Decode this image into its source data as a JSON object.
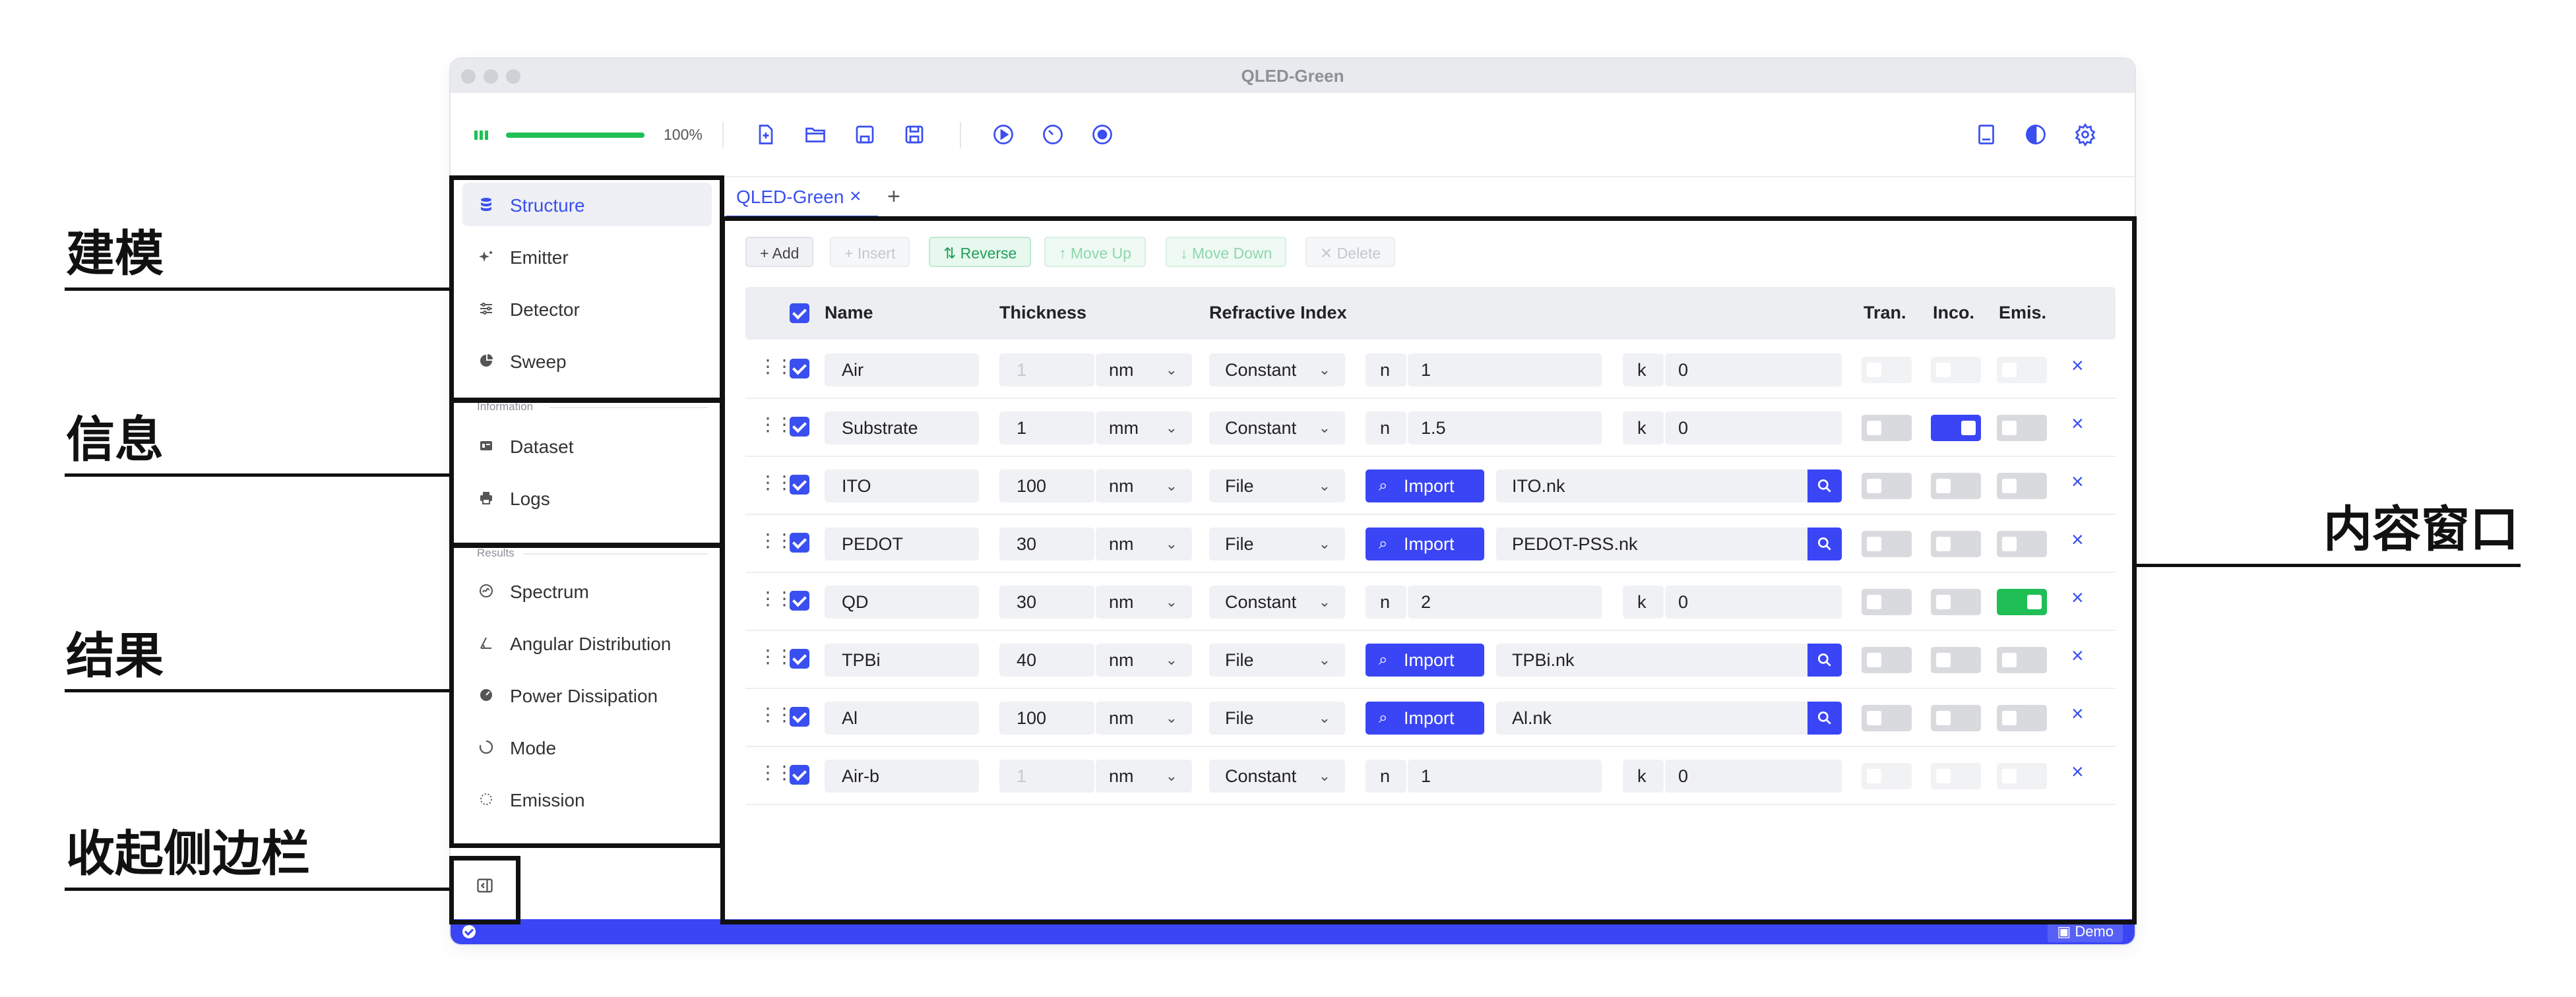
{
  "annotations": {
    "modeling": "建模",
    "info": "信息",
    "results": "结果",
    "collapse_sidebar": "收起侧边栏",
    "content_window": "内容窗口"
  },
  "window": {
    "title": "QLED-Green"
  },
  "toolbar": {
    "progress_percent": "100%",
    "progress_fraction": 1.0,
    "left_icons": [
      "new-file-icon",
      "open-folder-icon",
      "save-icon",
      "save-as-icon"
    ],
    "run_icons": [
      "play-icon",
      "timer-icon",
      "record-icon"
    ],
    "right_icons": [
      "book-icon",
      "theme-icon",
      "settings-icon"
    ]
  },
  "sidebar": {
    "items": [
      {
        "label": "Structure",
        "icon": "database-icon"
      },
      {
        "label": "Emitter",
        "icon": "sparkle-icon"
      },
      {
        "label": "Detector",
        "icon": "sliders-icon"
      },
      {
        "label": "Sweep",
        "icon": "pie-icon"
      }
    ],
    "info_section": "Information",
    "info_items": [
      {
        "label": "Dataset",
        "icon": "dataset-icon"
      },
      {
        "label": "Logs",
        "icon": "printer-icon"
      }
    ],
    "results_section": "Results",
    "results_items": [
      {
        "label": "Spectrum",
        "icon": "spectrum-icon"
      },
      {
        "label": "Angular Distribution",
        "icon": "angle-icon"
      },
      {
        "label": "Power Dissipation",
        "icon": "power-icon"
      },
      {
        "label": "Mode",
        "icon": "mode-icon"
      },
      {
        "label": "Emission",
        "icon": "emission-icon"
      }
    ]
  },
  "tabs": [
    {
      "label": "QLED-Green"
    }
  ],
  "actions": {
    "add": "+ Add",
    "insert": "+ Insert",
    "reverse": "⇅ Reverse",
    "move_up": "↑ Move Up",
    "move_down": "↓ Move Down",
    "delete": "✕ Delete"
  },
  "table": {
    "headers": {
      "name": "Name",
      "thickness": "Thickness",
      "refractive_index": "Refractive Index",
      "tran": "Tran.",
      "inco": "Inco.",
      "emis": "Emis."
    },
    "rows": [
      {
        "name": "Air",
        "thickness": "1",
        "unit": "nm",
        "method": "Constant",
        "n": "1",
        "k": "0",
        "file": "",
        "tran": false,
        "inco": false,
        "emis": false,
        "muted": true
      },
      {
        "name": "Substrate",
        "thickness": "1",
        "unit": "mm",
        "method": "Constant",
        "n": "1.5",
        "k": "0",
        "file": "",
        "tran": false,
        "inco": true,
        "emis": false,
        "muted": false
      },
      {
        "name": "ITO",
        "thickness": "100",
        "unit": "nm",
        "method": "File",
        "file": "ITO.nk",
        "import_label": "Import",
        "tran": false,
        "inco": false,
        "emis": false,
        "muted": false
      },
      {
        "name": "PEDOT",
        "thickness": "30",
        "unit": "nm",
        "method": "File",
        "file": "PEDOT-PSS.nk",
        "import_label": "Import",
        "tran": false,
        "inco": false,
        "emis": false,
        "muted": false
      },
      {
        "name": "QD",
        "thickness": "30",
        "unit": "nm",
        "method": "Constant",
        "n": "2",
        "k": "0",
        "file": "",
        "tran": false,
        "inco": false,
        "emis": true,
        "muted": false
      },
      {
        "name": "TPBi",
        "thickness": "40",
        "unit": "nm",
        "method": "File",
        "file": "TPBi.nk",
        "import_label": "Import",
        "tran": false,
        "inco": false,
        "emis": false,
        "muted": false
      },
      {
        "name": "Al",
        "thickness": "100",
        "unit": "nm",
        "method": "File",
        "file": "Al.nk",
        "import_label": "Import",
        "tran": false,
        "inco": false,
        "emis": false,
        "muted": false
      },
      {
        "name": "Air-b",
        "thickness": "1",
        "unit": "nm",
        "method": "Constant",
        "n": "1",
        "k": "0",
        "file": "",
        "tran": false,
        "inco": false,
        "emis": false,
        "muted": true
      }
    ],
    "n_label": "n",
    "k_label": "k"
  },
  "statusbar": {
    "mode": "Demo"
  },
  "colors": {
    "accent": "#3a45f5",
    "green": "#1fbf55",
    "progress": "#1fbf55"
  }
}
